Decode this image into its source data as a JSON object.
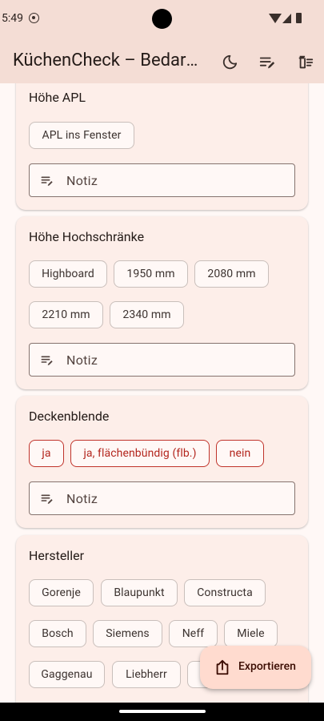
{
  "status": {
    "time": "5:49"
  },
  "app_bar": {
    "title": "KüchenCheck – Bedarfsanalyse"
  },
  "cards": [
    {
      "title": "Höhe APL",
      "chips": [
        "APL ins Fenster"
      ],
      "note_label": "Notiz"
    },
    {
      "title": "Höhe Hochschränke",
      "chips": [
        "Highboard",
        "1950 mm",
        "2080 mm",
        "2210 mm",
        "2340 mm"
      ],
      "note_label": "Notiz"
    },
    {
      "title": "Deckenblende",
      "chips": [
        "ja",
        "ja, flächenbündig (flb.)",
        "nein"
      ],
      "note_label": "Notiz"
    },
    {
      "title": "Hersteller",
      "chips": [
        "Gorenje",
        "Blaupunkt",
        "Constructa",
        "Bosch",
        "Siemens",
        "Neff",
        "Miele",
        "Gaggenau",
        "Liebherr"
      ]
    }
  ],
  "fab": {
    "label": "Exportieren"
  },
  "colors": {
    "accent_red": "#b3261e",
    "app_bar": "#f4ddd5",
    "card": "#fdeee9",
    "fab": "#ffdbcf"
  }
}
